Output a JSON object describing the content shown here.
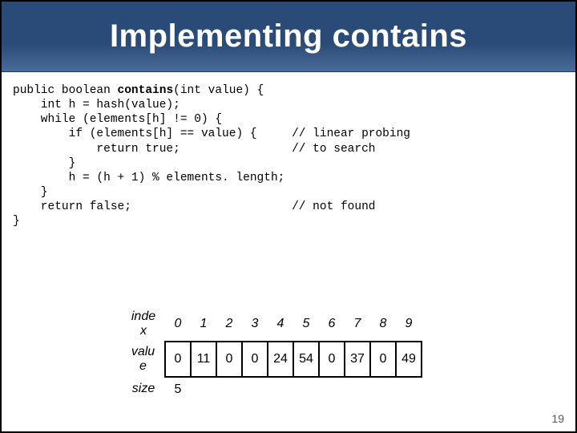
{
  "title": "Implementing contains",
  "code": {
    "l1a": "public boolean ",
    "l1b": "contains",
    "l1c": "(int value) {",
    "l2": "    int h = hash(value);",
    "l3": "    while (elements[h] != 0) {",
    "l4a": "        if (elements[h] == value) {     ",
    "l4b": "// linear probing",
    "l5a": "            return true;                ",
    "l5b": "// to search",
    "l6": "        }",
    "l7": "        h = (h + 1) % elements. length;",
    "l8": "    }",
    "l9a": "    return false;                       ",
    "l9b": "// not found",
    "l10": "}"
  },
  "table": {
    "indexLabel": "inde x",
    "valueLabel": "valu e",
    "sizeLabel": "size",
    "indices": [
      "0",
      "1",
      "2",
      "3",
      "4",
      "5",
      "6",
      "7",
      "8",
      "9"
    ],
    "values": [
      "0",
      "11",
      "0",
      "0",
      "24",
      "54",
      "0",
      "37",
      "0",
      "49"
    ],
    "size": "5"
  },
  "pageNumber": "19"
}
